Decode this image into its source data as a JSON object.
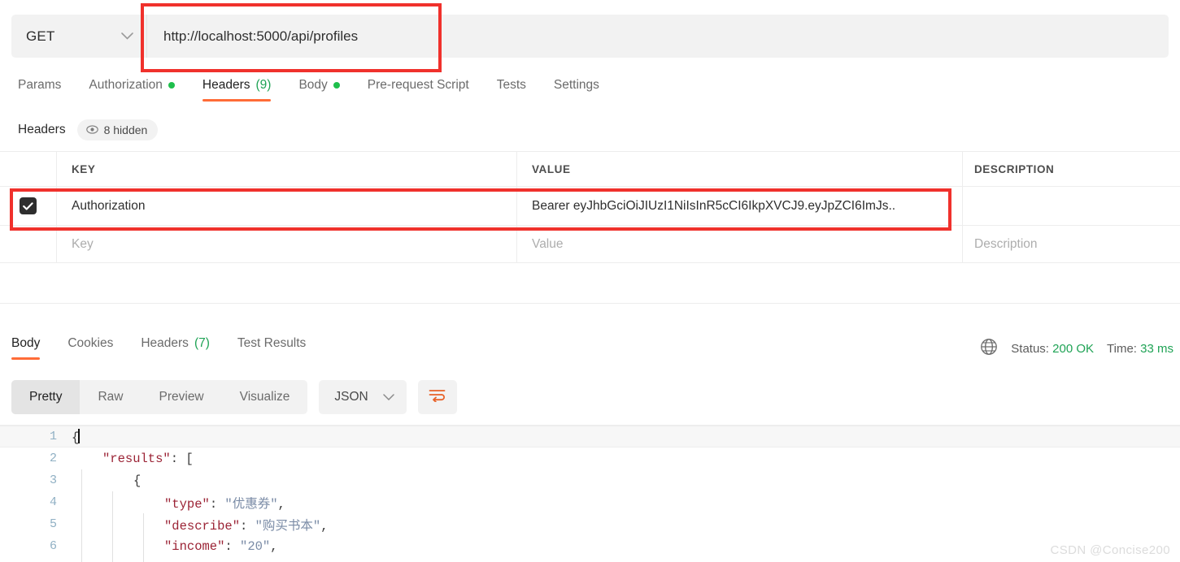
{
  "request": {
    "method": "GET",
    "url": "http://localhost:5000/api/profiles",
    "tabs": [
      {
        "label": "Params",
        "dot": false,
        "count": "",
        "active": false
      },
      {
        "label": "Authorization",
        "dot": true,
        "count": "",
        "active": false
      },
      {
        "label": "Headers",
        "dot": false,
        "count": "(9)",
        "active": true
      },
      {
        "label": "Body",
        "dot": true,
        "count": "",
        "active": false
      },
      {
        "label": "Pre-request Script",
        "dot": false,
        "count": "",
        "active": false
      },
      {
        "label": "Tests",
        "dot": false,
        "count": "",
        "active": false
      },
      {
        "label": "Settings",
        "dot": false,
        "count": "",
        "active": false
      }
    ]
  },
  "headers_section": {
    "title": "Headers",
    "hidden_badge": "8 hidden",
    "columns": {
      "key": "KEY",
      "value": "VALUE",
      "description": "DESCRIPTION"
    },
    "rows": [
      {
        "checked": true,
        "key": "Authorization",
        "value": "Bearer eyJhbGciOiJIUzI1NiIsInR5cCI6IkpXVCJ9.eyJpZCI6ImJs..",
        "description": ""
      }
    ],
    "placeholders": {
      "key": "Key",
      "value": "Value",
      "description": "Description"
    }
  },
  "response": {
    "tabs": [
      {
        "label": "Body",
        "count": "",
        "active": true
      },
      {
        "label": "Cookies",
        "count": "",
        "active": false
      },
      {
        "label": "Headers",
        "count": "(7)",
        "active": false
      },
      {
        "label": "Test Results",
        "count": "",
        "active": false
      }
    ],
    "status_label": "Status:",
    "status_value": "200 OK",
    "time_label": "Time:",
    "time_value": "33 ms",
    "viewer": {
      "modes": [
        {
          "label": "Pretty",
          "active": true
        },
        {
          "label": "Raw",
          "active": false
        },
        {
          "label": "Preview",
          "active": false
        },
        {
          "label": "Visualize",
          "active": false
        }
      ],
      "format": "JSON"
    },
    "code_lines": [
      {
        "n": "1",
        "indent": 0,
        "tokens": [
          {
            "t": "{",
            "c": "p"
          }
        ],
        "cursor": true
      },
      {
        "n": "2",
        "indent": 1,
        "tokens": [
          {
            "t": "\"results\"",
            "c": "k"
          },
          {
            "t": ": [",
            "c": "p"
          }
        ],
        "cursor": false
      },
      {
        "n": "3",
        "indent": 2,
        "tokens": [
          {
            "t": "{",
            "c": "p"
          }
        ],
        "cursor": false
      },
      {
        "n": "4",
        "indent": 3,
        "tokens": [
          {
            "t": "\"type\"",
            "c": "k"
          },
          {
            "t": ": ",
            "c": "p"
          },
          {
            "t": "\"优惠券\"",
            "c": "s"
          },
          {
            "t": ",",
            "c": "p"
          }
        ],
        "cursor": false
      },
      {
        "n": "5",
        "indent": 3,
        "tokens": [
          {
            "t": "\"describe\"",
            "c": "k"
          },
          {
            "t": ": ",
            "c": "p"
          },
          {
            "t": "\"购买书本\"",
            "c": "s"
          },
          {
            "t": ",",
            "c": "p"
          }
        ],
        "cursor": false
      },
      {
        "n": "6",
        "indent": 3,
        "tokens": [
          {
            "t": "\"income\"",
            "c": "k"
          },
          {
            "t": ": ",
            "c": "p"
          },
          {
            "t": "\"20\"",
            "c": "s"
          },
          {
            "t": ",",
            "c": "p"
          }
        ],
        "cursor": false
      }
    ]
  },
  "watermark": "CSDN @Concise200",
  "colors": {
    "accent_orange": "#ff6c37",
    "status_green": "#1fa355",
    "dot_green": "#1fbf4c",
    "annotation_red": "#f0312c"
  }
}
